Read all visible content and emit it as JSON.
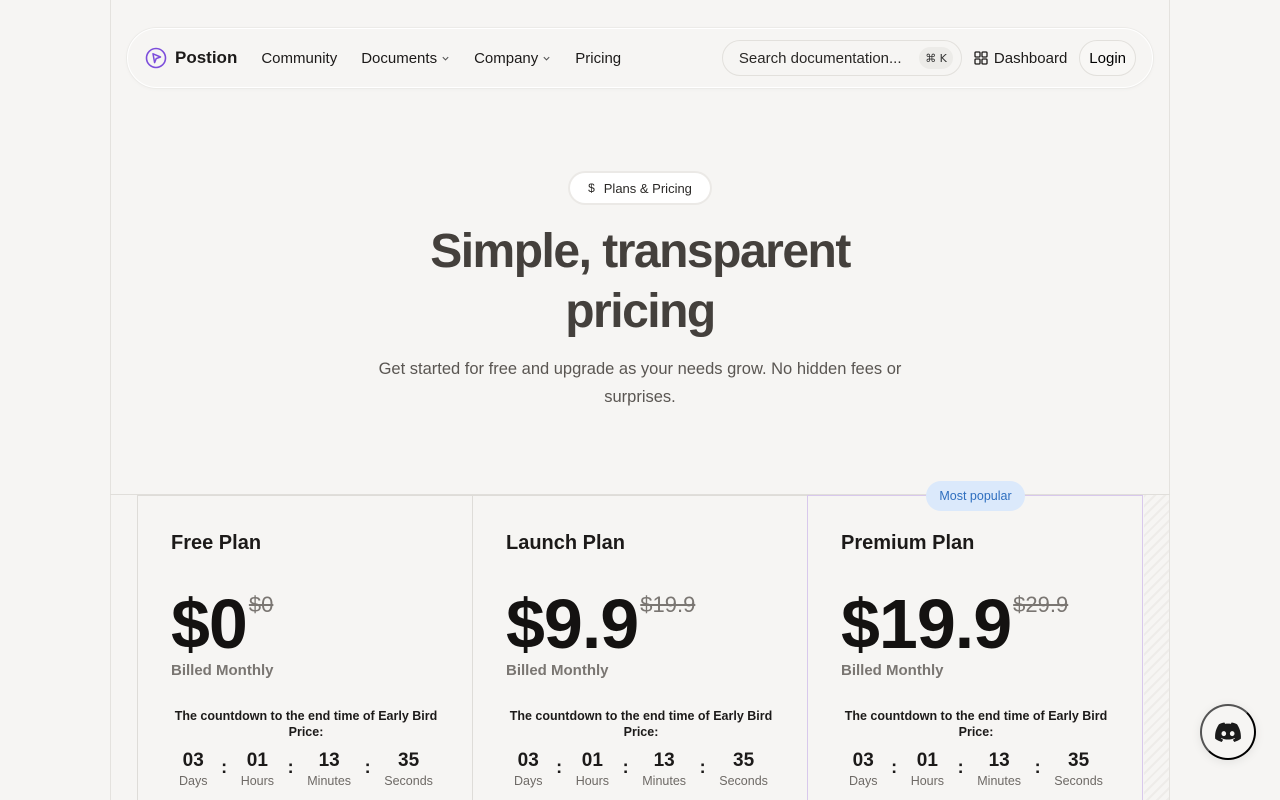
{
  "nav": {
    "brand": "Postion",
    "links": [
      {
        "label": "Community",
        "dropdown": false
      },
      {
        "label": "Documents",
        "dropdown": true
      },
      {
        "label": "Company",
        "dropdown": true
      },
      {
        "label": "Pricing",
        "dropdown": false
      }
    ],
    "search_placeholder": "Search documentation...",
    "search_shortcut": "⌘ K",
    "dashboard_label": "Dashboard",
    "login_label": "Login"
  },
  "hero": {
    "badge": "Plans & Pricing",
    "badge_icon": "$",
    "title_line1": "Simple, transparent",
    "title_line2": "pricing",
    "subtitle": "Get started for free and upgrade as your needs grow. No hidden fees or surprises."
  },
  "popular_badge": "Most popular",
  "plans": [
    {
      "name": "Free Plan",
      "price": "$0",
      "old_price": "$0",
      "billing": "Billed Monthly",
      "countdown_title": "The countdown to the end time of Early Bird Price:",
      "countdown": {
        "days": "03",
        "hours": "01",
        "minutes": "13",
        "seconds": "35"
      }
    },
    {
      "name": "Launch Plan",
      "price": "$9.9",
      "old_price": "$19.9",
      "billing": "Billed Monthly",
      "countdown_title": "The countdown to the end time of Early Bird Price:",
      "countdown": {
        "days": "03",
        "hours": "01",
        "minutes": "13",
        "seconds": "35"
      }
    },
    {
      "name": "Premium Plan",
      "price": "$19.9",
      "old_price": "$29.9",
      "billing": "Billed Monthly",
      "countdown_title": "The countdown to the end time of Early Bird Price:",
      "countdown": {
        "days": "03",
        "hours": "01",
        "minutes": "13",
        "seconds": "35"
      }
    }
  ],
  "countdown_labels": {
    "days": "Days",
    "hours": "Hours",
    "minutes": "Minutes",
    "seconds": "Seconds"
  },
  "countdown_separator": ":",
  "colors": {
    "background": "#f6f5f3",
    "brand_purple": "#7c4ddb",
    "popular_bg": "#dbe9fb",
    "popular_text": "#2f6fbf",
    "premium_border": "#d8c8ec"
  },
  "icons": {
    "logo": "play-circle-icon",
    "dashboard": "grid-icon",
    "chevron": "chevron-down-icon",
    "discord": "discord-icon"
  }
}
